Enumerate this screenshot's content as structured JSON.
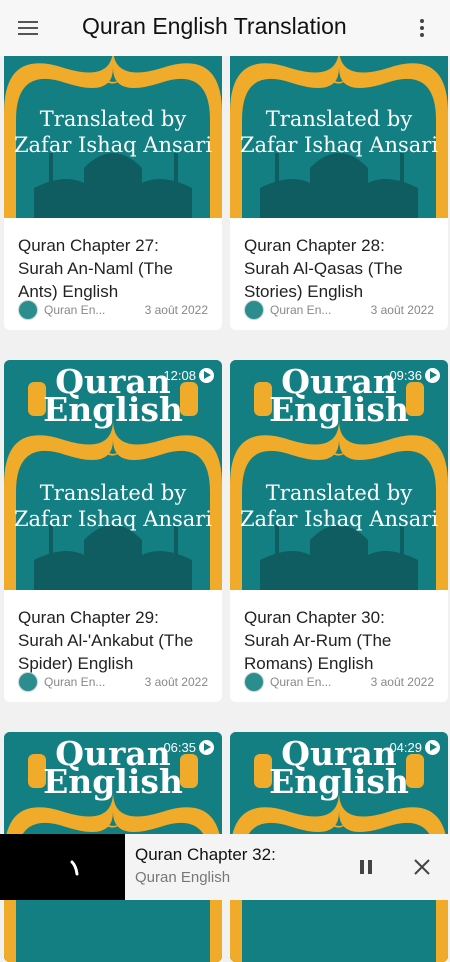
{
  "appbar": {
    "title": "Quran English Translation",
    "menu_icon": "hamburger-menu-icon",
    "more_icon": "more-vert-icon"
  },
  "thumb_text": {
    "quran": "Quran",
    "english": "English",
    "translated_by": "Translated by",
    "translator": "Zafar Ishaq Ansari"
  },
  "colors": {
    "teal": "#147f83",
    "gold": "#f0ab2b",
    "dark_teal": "#0f5d60"
  },
  "cards": [
    {
      "title": "Quran Chapter 27: Surah An-Naml (The Ants) English",
      "channel": "Quran En...",
      "date": "3 août 2022",
      "duration": ""
    },
    {
      "title": "Quran Chapter 28: Surah Al-Qasas (The Stories) English",
      "channel": "Quran En...",
      "date": "3 août 2022",
      "duration": ""
    },
    {
      "title": "Quran Chapter 29: Surah Al-'Ankabut (The Spider) English",
      "channel": "Quran En...",
      "date": "3 août 2022",
      "duration": "12:08"
    },
    {
      "title": "Quran Chapter 30: Surah Ar-Rum (The Romans) English",
      "channel": "Quran En...",
      "date": "3 août 2022",
      "duration": "09:36"
    },
    {
      "title": "",
      "channel": "",
      "date": "",
      "duration": "06:35"
    },
    {
      "title": "",
      "channel": "",
      "date": "",
      "duration": "04:29"
    }
  ],
  "player": {
    "title": "Quran Chapter 32:",
    "subtitle": "Quran English",
    "pause_icon": "pause-icon",
    "close_icon": "close-icon"
  }
}
